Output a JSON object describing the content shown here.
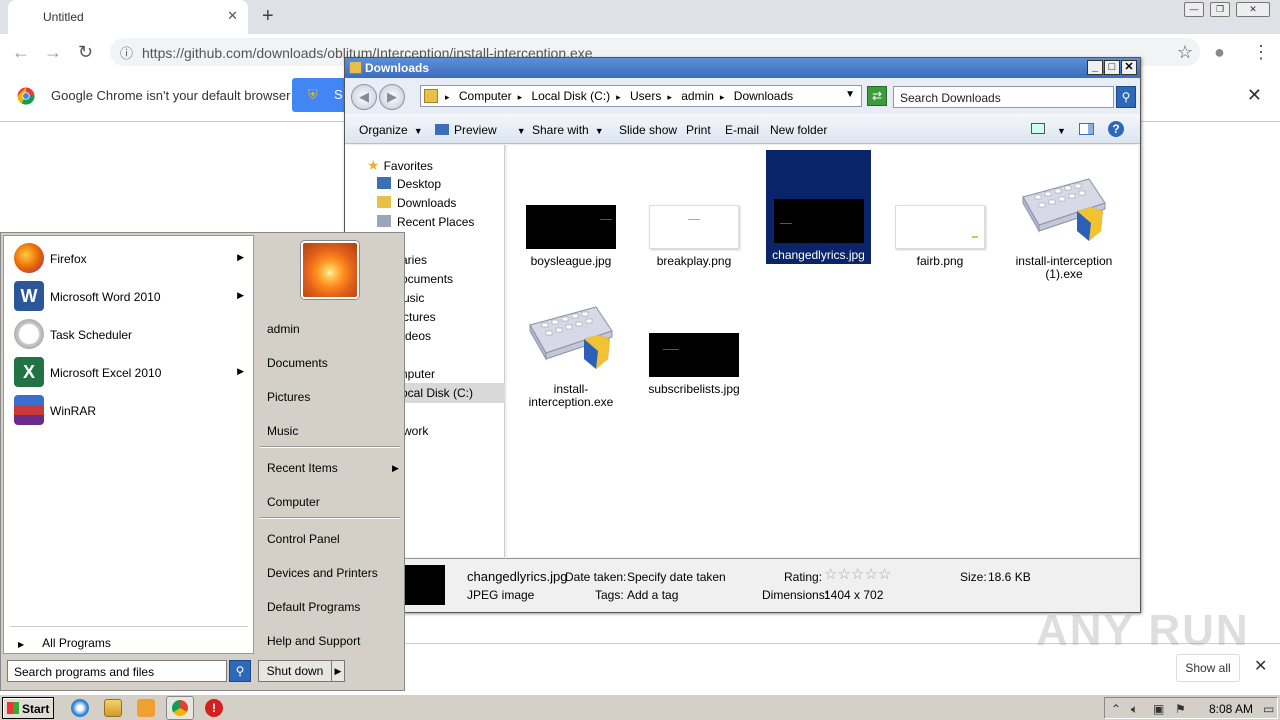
{
  "browser": {
    "tab_title": "Untitled",
    "url": "https://github.com/downloads/oblitum/Interception/install-interception.exe",
    "default_msg": "Google Chrome isn't your default browser",
    "default_btn_label": "S",
    "show_all": "Show all",
    "watermark": "ANY RUN"
  },
  "explorer": {
    "title": "Downloads",
    "breadcrumbs": [
      "Computer",
      "Local Disk (C:)",
      "Users",
      "admin",
      "Downloads"
    ],
    "search_placeholder": "Search Downloads",
    "commands": [
      "Organize",
      "Preview",
      "Share with",
      "Slide show",
      "Print",
      "E-mail",
      "New folder"
    ],
    "nav": {
      "favorites": "Favorites",
      "desktop": "Desktop",
      "downloads": "Downloads",
      "recent": "Recent Places",
      "libraries": "aries",
      "documents": "ocuments",
      "music": "usic",
      "pictures": "ctures",
      "videos": "deos",
      "computer": "nputer",
      "localdisk": "ocal Disk (C:)",
      "network": "work"
    },
    "files": [
      {
        "name": "boysleague.jpg",
        "kind": "dark"
      },
      {
        "name": "breakplay.png",
        "kind": "light"
      },
      {
        "name": "changedlyrics.jpg",
        "kind": "dark",
        "selected": true
      },
      {
        "name": "fairb.png",
        "kind": "light"
      },
      {
        "name": "install-interception (1).exe",
        "kind": "exe"
      },
      {
        "name": "install-interception.exe",
        "kind": "exe"
      },
      {
        "name": "subscribelists.jpg",
        "kind": "dark"
      }
    ],
    "details": {
      "name": "changedlyrics.jpg",
      "type": "JPEG image",
      "date_label": "Date taken:",
      "date_value": "Specify date taken",
      "tags_label": "Tags:",
      "tags_value": "Add a tag",
      "rating_label": "Rating:",
      "dimensions_label": "Dimensions:",
      "dimensions_value": "1404 x 702",
      "size_label": "Size:",
      "size_value": "18.6 KB"
    }
  },
  "start_menu": {
    "programs": [
      {
        "label": "Firefox",
        "submenu": true,
        "icon": "firefox-icon",
        "color": "#e66000"
      },
      {
        "label": "Microsoft Word 2010",
        "submenu": true,
        "icon": "word-icon",
        "color": "#2b579a"
      },
      {
        "label": "Task Scheduler",
        "submenu": false,
        "icon": "clock-icon",
        "color": "#cfcfcf"
      },
      {
        "label": "Microsoft Excel 2010",
        "submenu": true,
        "icon": "excel-icon",
        "color": "#217346"
      },
      {
        "label": "WinRAR",
        "submenu": false,
        "icon": "winrar-icon",
        "color": "#8b1a4a"
      }
    ],
    "all_programs": "All Programs",
    "search_placeholder": "Search programs and files",
    "right_items": {
      "user": "admin",
      "documents": "Documents",
      "pictures": "Pictures",
      "music": "Music",
      "recent": "Recent Items",
      "computer": "Computer",
      "control_panel": "Control Panel",
      "devices": "Devices and Printers",
      "default_programs": "Default Programs",
      "help": "Help and Support"
    },
    "shutdown": "Shut down"
  },
  "taskbar": {
    "start": "Start",
    "clock": "8:08 AM"
  }
}
